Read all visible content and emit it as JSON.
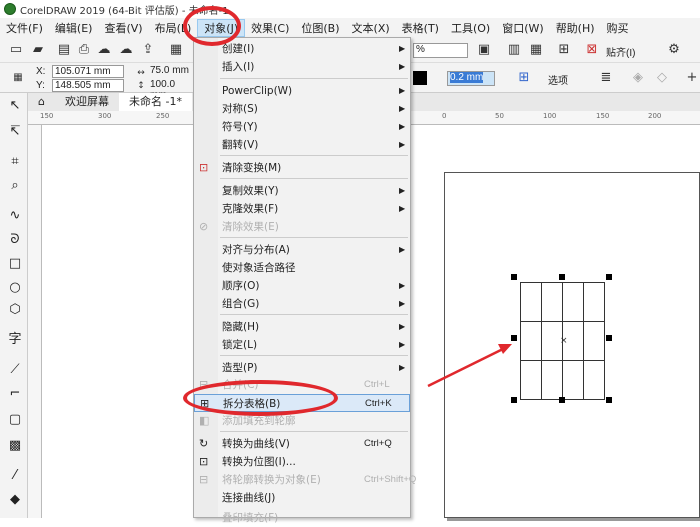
{
  "window": {
    "title": "CorelDRAW 2019 (64-Bit 评估版) - 未命名-1"
  },
  "menubar": {
    "items": [
      "文件(F)",
      "编辑(E)",
      "查看(V)",
      "布局(L)",
      "对象(J)",
      "效果(C)",
      "位图(B)",
      "文本(X)",
      "表格(T)",
      "工具(O)",
      "窗口(W)",
      "帮助(H)",
      "购买"
    ]
  },
  "toolbar": {
    "x_label": "X:",
    "y_label": "Y:",
    "x_value": "105.071 mm",
    "y_value": "148.505 mm",
    "w_value": "75.0 mm",
    "h_value": "100.0 mm",
    "percent": "%",
    "outline_width": "0.2 mm",
    "snap_label": "贴齐(I)",
    "options_label": "选项"
  },
  "tabs": {
    "welcome": "欢迎屏幕",
    "document": "未命名 -1*"
  },
  "ruler": {
    "top": [
      "150",
      "300",
      "250",
      "50",
      "0",
      "50",
      "100",
      "150",
      "200"
    ]
  },
  "menu": {
    "items": [
      {
        "label": "创建(I)",
        "shortcut": "",
        "arrow": true,
        "disabled": false
      },
      {
        "label": "插入(I)",
        "shortcut": "",
        "arrow": true,
        "disabled": false
      },
      {
        "label": "PowerClip(W)",
        "shortcut": "",
        "arrow": true,
        "disabled": false
      },
      {
        "label": "对称(S)",
        "shortcut": "",
        "arrow": true,
        "disabled": false
      },
      {
        "label": "符号(Y)",
        "shortcut": "",
        "arrow": true,
        "disabled": false
      },
      {
        "label": "翻转(V)",
        "shortcut": "",
        "arrow": true,
        "disabled": false
      },
      {
        "label": "清除变换(M)",
        "shortcut": "",
        "arrow": false,
        "disabled": false
      },
      {
        "label": "复制效果(Y)",
        "shortcut": "",
        "arrow": true,
        "disabled": false
      },
      {
        "label": "克隆效果(F)",
        "shortcut": "",
        "arrow": true,
        "disabled": false
      },
      {
        "label": "清除效果(E)",
        "shortcut": "",
        "arrow": false,
        "disabled": true
      },
      {
        "label": "对齐与分布(A)",
        "shortcut": "",
        "arrow": true,
        "disabled": false
      },
      {
        "label": "使对象适合路径",
        "shortcut": "",
        "arrow": false,
        "disabled": false
      },
      {
        "label": "顺序(O)",
        "shortcut": "",
        "arrow": true,
        "disabled": false
      },
      {
        "label": "组合(G)",
        "shortcut": "",
        "arrow": true,
        "disabled": false
      },
      {
        "label": "隐藏(H)",
        "shortcut": "",
        "arrow": true,
        "disabled": false
      },
      {
        "label": "锁定(L)",
        "shortcut": "",
        "arrow": true,
        "disabled": false
      },
      {
        "label": "造型(P)",
        "shortcut": "",
        "arrow": true,
        "disabled": false
      },
      {
        "label": "合并(C)",
        "shortcut": "Ctrl+L",
        "arrow": false,
        "disabled": true
      },
      {
        "label": "拆分表格(B)",
        "shortcut": "Ctrl+K",
        "arrow": false,
        "disabled": false
      },
      {
        "label": "添加填充到轮廓",
        "shortcut": "",
        "arrow": false,
        "disabled": true
      },
      {
        "label": "转换为曲线(V)",
        "shortcut": "Ctrl+Q",
        "arrow": false,
        "disabled": false
      },
      {
        "label": "转换为位图(I)...",
        "shortcut": "",
        "arrow": false,
        "disabled": false
      },
      {
        "label": "将轮廓转换为对象(E)",
        "shortcut": "Ctrl+Shift+Q",
        "arrow": false,
        "disabled": true
      },
      {
        "label": "连接曲线(J)",
        "shortcut": "",
        "arrow": false,
        "disabled": false
      },
      {
        "label": "叠印填充(F)",
        "shortcut": "",
        "arrow": false,
        "disabled": true
      }
    ]
  },
  "colors": {
    "highlight": "#dbe9f8",
    "annotation": "#e0282d"
  }
}
